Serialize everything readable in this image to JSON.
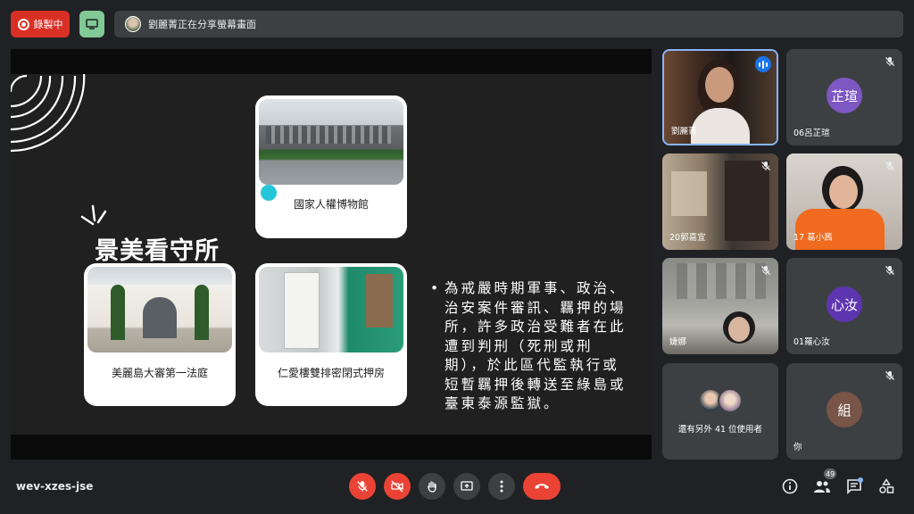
{
  "topbar": {
    "recording_label": "錄製中",
    "share_status": "劉麗菁正在分享螢幕畫面"
  },
  "slide": {
    "title": "景美看守所",
    "cards": [
      {
        "caption": "國家人權博物館"
      },
      {
        "caption": "美麗島大審第一法庭"
      },
      {
        "caption": "仁愛樓雙排密閉式押房"
      }
    ],
    "bullet": "為戒嚴時期軍事、政治、治安案件審訊、羈押的場所，許多政治受難者在此遭到判刑（死刑或刑期），於此區代監執行或短暫羈押後轉送至綠島或臺東泰源監獄。"
  },
  "participants": [
    {
      "name": "劉麗菁",
      "speaking": true
    },
    {
      "name": "06呂芷瑄",
      "initials": "芷瑄",
      "avatar_color": "#7e57c2",
      "muted": true
    },
    {
      "name": "20郭嘉宜",
      "muted": true
    },
    {
      "name": "17 葛小茜",
      "muted": true
    },
    {
      "name": "婕娜",
      "muted": true
    },
    {
      "name": "01羅心汝",
      "initials": "心汝",
      "avatar_color": "#5e35b1",
      "muted": true
    },
    {
      "name": "還有另外 41 位使用者"
    },
    {
      "name": "你",
      "initials": "組",
      "avatar_color": "#795548",
      "muted": true
    }
  ],
  "bottombar": {
    "meeting_code": "wev-xzes-jse",
    "participant_count": "49"
  },
  "colors": {
    "accent": "#8ab4f8",
    "danger": "#ea4335",
    "surface": "#3c4043",
    "background": "#202124"
  }
}
